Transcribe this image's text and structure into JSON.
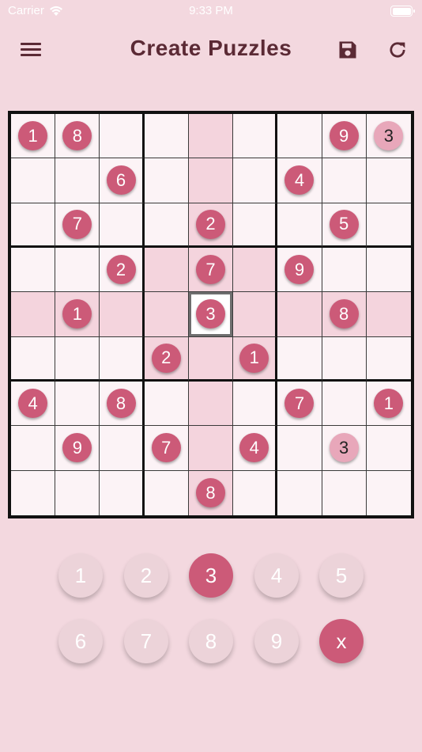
{
  "status_bar": {
    "carrier": "Carrier",
    "time": "9:33 PM"
  },
  "header": {
    "title": "Create Puzzles",
    "icons": [
      "menu-icon",
      "save-icon",
      "refresh-icon"
    ]
  },
  "colors": {
    "background": "#f3d8df",
    "accent": "#cc5a78",
    "user_entry": "#e8a7ba",
    "title": "#5b2a35"
  },
  "board": {
    "selected": [
      4,
      4
    ],
    "rows": [
      [
        "1",
        "8",
        "",
        "",
        "",
        "",
        "",
        "9",
        "3"
      ],
      [
        "",
        "",
        "6",
        "",
        "",
        "",
        "4",
        "",
        ""
      ],
      [
        "",
        "7",
        "",
        "",
        "2",
        "",
        "",
        "5",
        ""
      ],
      [
        "",
        "",
        "2",
        "",
        "7",
        "",
        "9",
        "",
        ""
      ],
      [
        "",
        "1",
        "",
        "",
        "3",
        "",
        "",
        "8",
        ""
      ],
      [
        "",
        "",
        "",
        "2",
        "",
        "1",
        "",
        "",
        ""
      ],
      [
        "4",
        "",
        "8",
        "",
        "",
        "",
        "7",
        "",
        "1"
      ],
      [
        "",
        "9",
        "",
        "7",
        "",
        "4",
        "",
        "3",
        ""
      ],
      [
        "",
        "",
        "",
        "",
        "8",
        "",
        "",
        "",
        ""
      ]
    ],
    "user_entries": [
      [
        0,
        8
      ],
      [
        7,
        7
      ]
    ]
  },
  "keypad": {
    "keys": [
      "1",
      "2",
      "3",
      "4",
      "5",
      "6",
      "7",
      "8",
      "9",
      "x"
    ],
    "active": "3"
  }
}
